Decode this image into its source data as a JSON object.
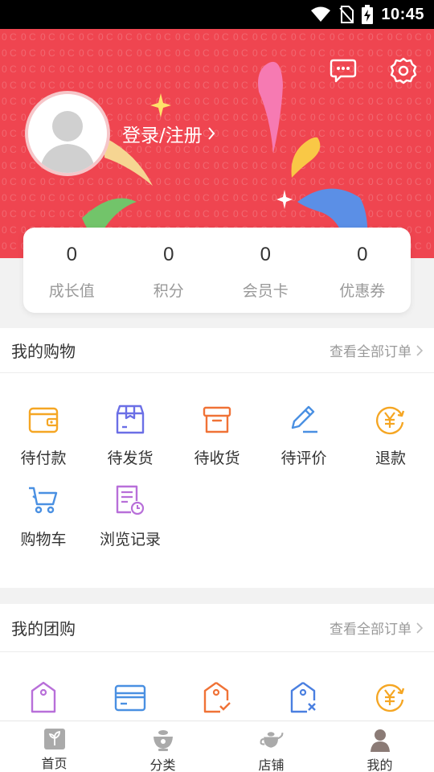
{
  "status_bar": {
    "time": "10:45"
  },
  "header": {
    "login_text": "登录/注册",
    "colors": {
      "background": "#ef4550"
    }
  },
  "stats": [
    {
      "value": "0",
      "label": "成长值"
    },
    {
      "value": "0",
      "label": "积分"
    },
    {
      "value": "0",
      "label": "会员卡"
    },
    {
      "value": "0",
      "label": "优惠券"
    }
  ],
  "shopping": {
    "title": "我的购物",
    "more": "查看全部订单",
    "items": [
      {
        "label": "待付款",
        "icon": "wallet-icon"
      },
      {
        "label": "待发货",
        "icon": "package-icon"
      },
      {
        "label": "待收货",
        "icon": "box-icon"
      },
      {
        "label": "待评价",
        "icon": "pen-icon"
      },
      {
        "label": "退款",
        "icon": "refund-yen-icon"
      },
      {
        "label": "购物车",
        "icon": "cart-icon"
      },
      {
        "label": "浏览记录",
        "icon": "history-icon"
      }
    ]
  },
  "group_buy": {
    "title": "我的团购",
    "more": "查看全部订单"
  },
  "tabbar": [
    {
      "label": "首页",
      "icon": "home-leaf-icon"
    },
    {
      "label": "分类",
      "icon": "category-bowl-icon"
    },
    {
      "label": "店铺",
      "icon": "store-teapot-icon"
    },
    {
      "label": "我的",
      "icon": "profile-icon"
    }
  ]
}
